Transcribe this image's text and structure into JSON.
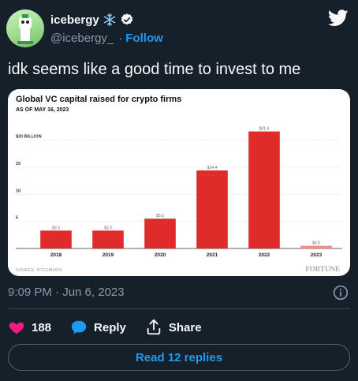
{
  "user": {
    "display_name": "icebergy",
    "handle": "@icebergy_",
    "separator": "·",
    "follow_label": "Follow"
  },
  "tweet": {
    "text": "idk seems like a good time to invest to me",
    "timestamp": "9:09 PM · Jun 6, 2023"
  },
  "actions": {
    "likes_count": "188",
    "reply_label": "Reply",
    "share_label": "Share",
    "read_replies_label": "Read 12 replies"
  },
  "colors": {
    "background": "#15202b",
    "accent": "#1d9bf0",
    "like": "#f91880",
    "bar": "#e02b2b",
    "bar_light": "#f08c8c"
  },
  "icons": [
    "snowflake-icon",
    "verified-icon",
    "twitter-logo",
    "info-icon",
    "heart-icon",
    "reply-icon",
    "share-icon"
  ],
  "chart_data": {
    "type": "bar",
    "title": "Global VC capital raised for crypto firms",
    "subtitle": "AS OF MAY 16, 2023",
    "ylabel_top": "$20 BILLION",
    "y_ticks": [
      "15",
      "10",
      "5"
    ],
    "ylim": [
      0,
      23
    ],
    "categories": [
      "2018",
      "2019",
      "2020",
      "2021",
      "2022",
      "2023"
    ],
    "values": [
      3.3,
      3.3,
      5.5,
      14.4,
      21.6,
      0.5
    ],
    "value_labels": [
      "$3.3",
      "$3.3",
      "$5.5",
      "$14.4",
      "$21.6",
      "$0.5"
    ],
    "source": "SOURCE: PITCHBOOK",
    "brand": "FORTUNE",
    "grid": true
  }
}
